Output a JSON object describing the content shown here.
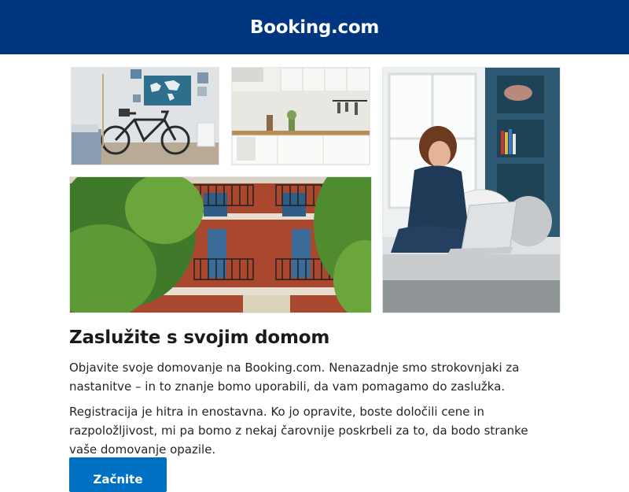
{
  "header": {
    "logo_text": "Booking.com",
    "background": "#003580"
  },
  "images": [
    {
      "id": "bedroom",
      "alt": "Room with bicycle and world map"
    },
    {
      "id": "kitchen",
      "alt": "White kitchen"
    },
    {
      "id": "building",
      "alt": "Brick building facade with balconies and trees"
    },
    {
      "id": "woman",
      "alt": "Woman using laptop on sofa"
    }
  ],
  "content": {
    "headline": "Zaslužite s svojim domom",
    "paragraph_1": "Objavite svoje domovanje na Booking.com. Nenazadnje smo strokovnjaki za nastanitve – in to znanje bomo uporabili, da vam pomagamo do zaslužka.",
    "paragraph_2": "Registracija je hitra in enostavna. Ko jo opravite, boste določili cene in razpoložljivost, mi pa bomo z nekaj čarovnije poskrbeli za to, da bodo stranke vaše domovanje opazile.",
    "cta_label": "Začnite",
    "cta_color": "#0071c2"
  }
}
